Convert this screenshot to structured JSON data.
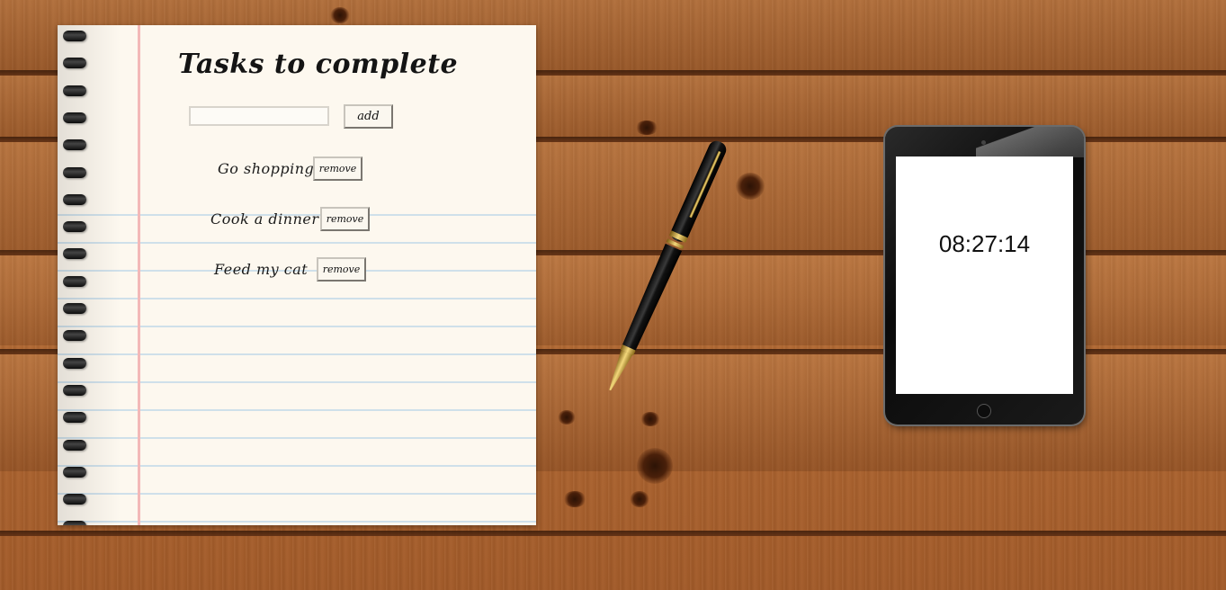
{
  "notebook": {
    "title": "Tasks to complete",
    "input": {
      "value": "",
      "placeholder": ""
    },
    "add_label": "add",
    "tasks": [
      {
        "label": "Go shopping",
        "remove_label": "remove"
      },
      {
        "label": "Cook a dinner",
        "remove_label": "remove"
      },
      {
        "label": "Feed my cat",
        "remove_label": "remove"
      }
    ]
  },
  "tablet": {
    "clock": "08:27:14"
  },
  "colors": {
    "wood": "#b56c35",
    "paper": "#fdf8ef",
    "margin_line": "#f3b8b8",
    "rule_line": "#cfe0ea"
  },
  "icons": [
    "pen-icon",
    "tablet-device"
  ]
}
